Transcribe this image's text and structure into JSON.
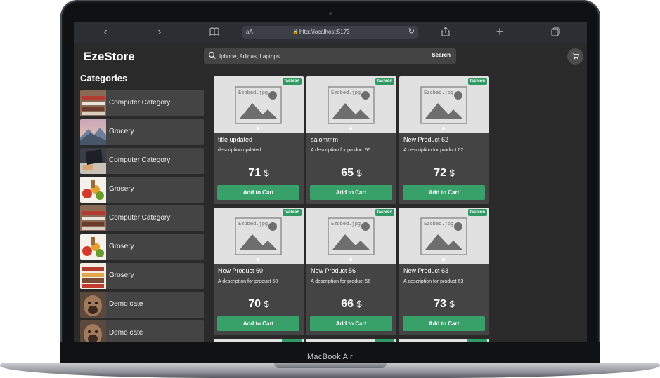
{
  "device": {
    "label": "MacBook Air"
  },
  "browser": {
    "reader_label": "aA",
    "url": "http://localhost:5173"
  },
  "app": {
    "logo": "EzeStore",
    "search": {
      "placeholder": "Iphone, Adidas, Laptops...",
      "button": "Search"
    },
    "cart_icon": "cart-icon"
  },
  "sidebar": {
    "title": "Categories",
    "items": [
      {
        "label": "Computer Category"
      },
      {
        "label": "Grocery"
      },
      {
        "label": "Computer Category"
      },
      {
        "label": "Grosery"
      },
      {
        "label": "Computer Category"
      },
      {
        "label": "Grosery"
      },
      {
        "label": "Grosery"
      },
      {
        "label": "Demo cate"
      },
      {
        "label": "Demo cate"
      }
    ]
  },
  "products": [
    {
      "badge": "fashion",
      "image_text": "Ezobed.jpg",
      "title": "title updated",
      "description": "description updated",
      "price": "71",
      "currency": "$",
      "button": "Add to Cart"
    },
    {
      "badge": "fashion",
      "image_text": "Ezobed.jpg",
      "title": "salommm",
      "description": "A description for product 55",
      "price": "65",
      "currency": "$",
      "button": "Add to Cart"
    },
    {
      "badge": "fashion",
      "image_text": "Ezobed.jpg",
      "title": "New Product 62",
      "description": "A description for product 62",
      "price": "72",
      "currency": "$",
      "button": "Add to Cart"
    },
    {
      "badge": "fashion",
      "image_text": "Ezobed.jpg",
      "title": "New Product 60",
      "description": "A description for product 60",
      "price": "70",
      "currency": "$",
      "button": "Add to Cart"
    },
    {
      "badge": "fashion",
      "image_text": "Ezobed.jpg",
      "title": "New Product 56",
      "description": "A description for product 56",
      "price": "66",
      "currency": "$",
      "button": "Add to Cart"
    },
    {
      "badge": "fashion",
      "image_text": "Ezobed.jpg",
      "title": "New Product 63",
      "description": "A description for product 63",
      "price": "73",
      "currency": "$",
      "button": "Add to Cart"
    }
  ]
}
